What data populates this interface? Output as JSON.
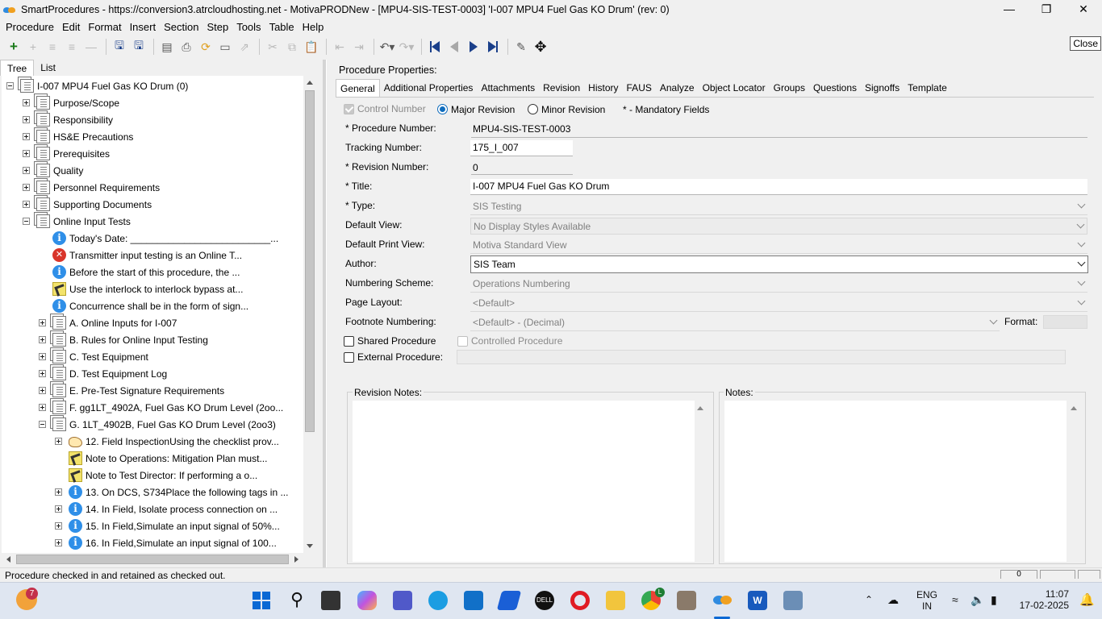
{
  "window": {
    "title": "SmartProcedures - https://conversion3.atrcloudhosting.net - MotivaPRODNew - [MPU4-SIS-TEST-0003] 'I-007 MPU4 Fuel Gas KO Drum' (rev: 0)",
    "close_tooltip": "Close"
  },
  "menu": [
    "Procedure",
    "Edit",
    "Format",
    "Insert",
    "Section",
    "Step",
    "Tools",
    "Table",
    "Help"
  ],
  "left_tabs": [
    "Tree",
    "List"
  ],
  "tree": [
    {
      "label": "I-007 MPU4 Fuel Gas KO Drum (0)",
      "icon": "docs",
      "exp": "minus",
      "level": 0
    },
    {
      "label": "Purpose/Scope",
      "icon": "docs",
      "exp": "plus",
      "level": 1
    },
    {
      "label": "Responsibility",
      "icon": "docs",
      "exp": "plus",
      "level": 1
    },
    {
      "label": "HS&E Precautions",
      "icon": "docs",
      "exp": "plus",
      "level": 1
    },
    {
      "label": "Prerequisites",
      "icon": "docs",
      "exp": "plus",
      "level": 1
    },
    {
      "label": "Quality",
      "icon": "docs",
      "exp": "plus",
      "level": 1
    },
    {
      "label": "Personnel Requirements",
      "icon": "docs",
      "exp": "plus",
      "level": 1
    },
    {
      "label": "Supporting Documents",
      "icon": "docs",
      "exp": "plus",
      "level": 1
    },
    {
      "label": "Online Input Tests",
      "icon": "docs",
      "exp": "minus",
      "level": 1
    },
    {
      "label": "Today's Date: __________________________...",
      "icon": "info",
      "exp": "none",
      "level": 2
    },
    {
      "label": "Transmitter input testing is an Online T...",
      "icon": "err",
      "exp": "none",
      "level": 2
    },
    {
      "label": "Before the start of this procedure, the ...",
      "icon": "info",
      "exp": "none",
      "level": 2
    },
    {
      "label": "Use the interlock to interlock bypass at...",
      "icon": "note",
      "exp": "none",
      "level": 2
    },
    {
      "label": "Concurrence shall be in the form of sign...",
      "icon": "info",
      "exp": "none",
      "level": 2
    },
    {
      "label": "A. Online Inputs for I-007",
      "icon": "docs",
      "exp": "plus",
      "level": 2
    },
    {
      "label": "B. Rules for Online Input Testing",
      "icon": "docs",
      "exp": "plus",
      "level": 2
    },
    {
      "label": "C. Test Equipment",
      "icon": "docs",
      "exp": "plus",
      "level": 2
    },
    {
      "label": "D. Test Equipment Log",
      "icon": "docs",
      "exp": "plus",
      "level": 2
    },
    {
      "label": "E. Pre-Test Signature Requirements",
      "icon": "docs",
      "exp": "plus",
      "level": 2
    },
    {
      "label": "F. gg1LT_4902A, Fuel Gas KO Drum Level (2oo...",
      "icon": "docs",
      "exp": "plus",
      "level": 2
    },
    {
      "label": "G. 1LT_4902B, Fuel Gas KO Drum Level (2oo3)",
      "icon": "docs",
      "exp": "minus",
      "level": 2
    },
    {
      "label": "12. Field InspectionUsing the checklist prov...",
      "icon": "hand",
      "exp": "plus",
      "level": 3
    },
    {
      "label": "Note to Operations: Mitigation Plan must...",
      "icon": "note",
      "exp": "none",
      "level": 3
    },
    {
      "label": "Note to Test Director: If performing a o...",
      "icon": "note",
      "exp": "none",
      "level": 3
    },
    {
      "label": "13. On DCS, S734Place the following tags in ...",
      "icon": "info",
      "exp": "plus",
      "level": 3
    },
    {
      "label": "14. In Field, Isolate process connection on ...",
      "icon": "info",
      "exp": "plus",
      "level": 3
    },
    {
      "label": "15. In Field,Simulate an input signal of 50%...",
      "icon": "info",
      "exp": "plus",
      "level": 3
    },
    {
      "label": "16. In Field,Simulate an input signal of 100...",
      "icon": "info",
      "exp": "plus",
      "level": 3
    }
  ],
  "right": {
    "heading": "Procedure Properties:",
    "tabs": [
      "General",
      "Additional Properties",
      "Attachments",
      "Revision",
      "History",
      "FAUS",
      "Analyze",
      "Object Locator",
      "Groups",
      "Questions",
      "Signoffs",
      "Template"
    ],
    "control_number": "Control Number",
    "major_revision": "Major Revision",
    "minor_revision": "Minor Revision",
    "mandatory_note": "* - Mandatory Fields",
    "procedure_number_label": "* Procedure Number:",
    "procedure_number": "MPU4-SIS-TEST-0003",
    "tracking_number_label": "Tracking Number:",
    "tracking_number": "175_I_007",
    "revision_number_label": "* Revision Number:",
    "revision_number": "0",
    "title_label": "* Title:",
    "title": "I-007 MPU4 Fuel Gas KO Drum",
    "type_label": "* Type:",
    "type": "SIS Testing",
    "default_view_label": "Default View:",
    "default_view": "No Display Styles Available",
    "default_print_view_label": "Default Print View:",
    "default_print_view": "Motiva Standard View",
    "author_label": "Author:",
    "author": "SIS Team",
    "numbering_scheme_label": "Numbering Scheme:",
    "numbering_scheme": "Operations Numbering",
    "page_layout_label": "Page Layout:",
    "page_layout": "<Default>",
    "footnote_numbering_label": "Footnote Numbering:",
    "footnote_numbering": "<Default> - (Decimal)",
    "format_label": "Format:",
    "shared_procedure": "Shared Procedure",
    "controlled_procedure": "Controlled Procedure",
    "external_procedure": "External Procedure:",
    "revision_notes": "Revision Notes:",
    "notes": "Notes:"
  },
  "status": {
    "message": "Procedure checked in and retained as checked out.",
    "counter": "0"
  },
  "taskbar": {
    "notification_badge": "7",
    "lang_line1": "ENG",
    "lang_line2": "IN",
    "time": "11:07",
    "date": "17-02-2025",
    "chrome_badge": "L"
  },
  "colors": {
    "accent": "#0f6cbd",
    "info_icon": "#2f8fe8",
    "error_icon": "#d9352b",
    "nav_blue": "#1a3f8a"
  }
}
